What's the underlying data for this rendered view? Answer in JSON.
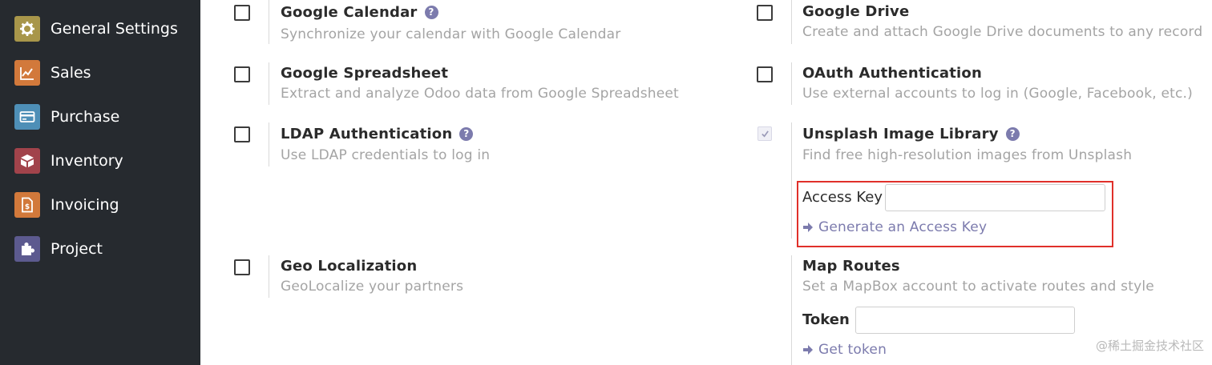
{
  "sidebar": {
    "items": [
      {
        "label": "General Settings",
        "icon": "gear-icon",
        "color": "#a8964a"
      },
      {
        "label": "Sales",
        "icon": "chart-icon",
        "color": "#d2793b"
      },
      {
        "label": "Purchase",
        "icon": "card-icon",
        "color": "#4e8fb7"
      },
      {
        "label": "Inventory",
        "icon": "box-icon",
        "color": "#a1434b"
      },
      {
        "label": "Invoicing",
        "icon": "invoice-icon",
        "color": "#d2793b"
      },
      {
        "label": "Project",
        "icon": "puzzle-icon",
        "color": "#5c5a8f"
      }
    ]
  },
  "settings": {
    "google_calendar": {
      "title": "Google Calendar",
      "desc": "Synchronize your calendar with Google Calendar",
      "checked": false
    },
    "google_drive": {
      "title": "Google Drive",
      "desc": "Create and attach Google Drive documents to any record",
      "checked": false
    },
    "google_spreadsheet": {
      "title": "Google Spreadsheet",
      "desc": "Extract and analyze Odoo data from Google Spreadsheet",
      "checked": false
    },
    "oauth": {
      "title": "OAuth Authentication",
      "desc": "Use external accounts to log in (Google, Facebook, etc.)",
      "checked": false
    },
    "ldap": {
      "title": "LDAP Authentication",
      "desc": "Use LDAP credentials to log in",
      "checked": false
    },
    "unsplash": {
      "title": "Unsplash Image Library",
      "desc": "Find free high-resolution images from Unsplash",
      "checked": true,
      "access_key_label": "Access Key",
      "access_key_value": "",
      "link_label": "Generate an Access Key"
    },
    "geo": {
      "title": "Geo Localization",
      "desc": "GeoLocalize your partners",
      "checked": false
    },
    "map_routes": {
      "title": "Map Routes",
      "desc": "Set a MapBox account to activate routes and style",
      "token_label": "Token",
      "token_value": "",
      "link_label": "Get token"
    }
  },
  "help_glyph": "?",
  "watermark": "@稀土掘金技术社区",
  "colors": {
    "sidebar_bg": "#262a2f",
    "accent": "#7c7bad",
    "highlight": "#e0302a"
  }
}
